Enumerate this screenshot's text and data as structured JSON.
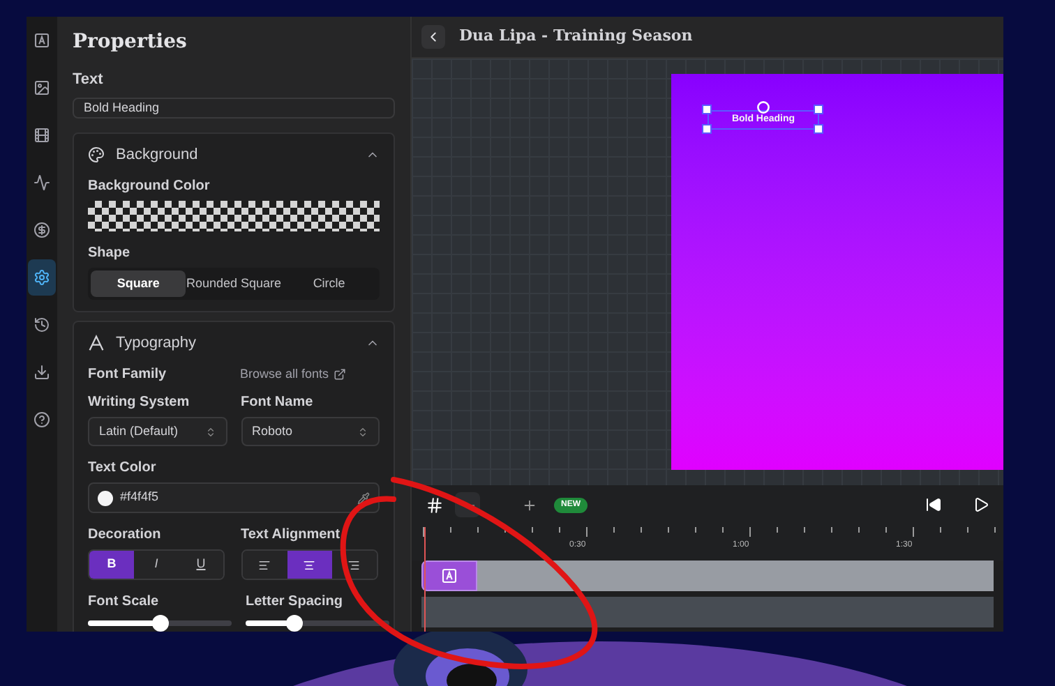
{
  "rail": [
    {
      "selected": false
    },
    {
      "selected": false
    },
    {
      "selected": false
    },
    {
      "selected": false
    },
    {
      "selected": false
    },
    {
      "selected": true
    },
    {
      "selected": false
    },
    {
      "selected": false
    },
    {
      "selected": false
    }
  ],
  "properties": {
    "title": "Properties",
    "text_label": "Text",
    "text_value": "Bold Heading"
  },
  "background_section": {
    "title": "Background",
    "expanded": true,
    "color_label": "Background Color",
    "shape_label": "Shape",
    "shapes": [
      {
        "label": "Square",
        "selected": true
      },
      {
        "label": "Rounded Square",
        "selected": false
      },
      {
        "label": "Circle",
        "selected": false
      }
    ]
  },
  "typography": {
    "title": "Typography",
    "expanded": true,
    "font_family_label": "Font Family",
    "browse_link": "Browse all fonts",
    "writing_system_label": "Writing System",
    "writing_system_value": "Latin (Default)",
    "font_name_label": "Font Name",
    "font_name_value": "Roboto",
    "text_color_label": "Text Color",
    "text_color": "#f4f4f5",
    "decoration_label": "Decoration",
    "decorations": [
      {
        "label": "B",
        "selected": true
      },
      {
        "label": "I",
        "selected": false
      },
      {
        "label": "U",
        "selected": false
      }
    ],
    "alignment_label": "Text Alignment",
    "alignments": [
      {
        "selected": false
      },
      {
        "selected": true
      },
      {
        "selected": false
      }
    ],
    "font_scale_label": "Font Scale",
    "font_scale": {
      "level": 0.5
    },
    "letter_spacing_label": "Letter Spacing",
    "letter_spacing": {
      "level": 0.34
    }
  },
  "editor": {
    "title": "Dua Lipa - Training Season",
    "canvas_text": "Bold Heading"
  },
  "timeline": {
    "badge": "NEW",
    "ticks": [
      "0:30",
      "1:00",
      "1:30"
    ]
  }
}
